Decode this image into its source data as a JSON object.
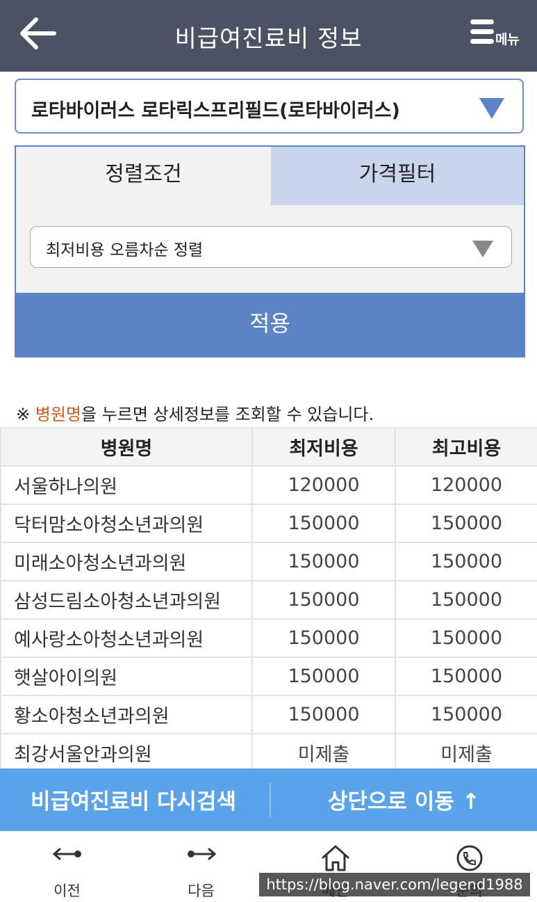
{
  "header": {
    "title": "비급여진료비 정보",
    "menu_label": "메뉴",
    "back_icon": "arrow-left-icon",
    "menu_icon": "hamburger-icon"
  },
  "product_select": {
    "value": "로타바이러스 로타릭스프리필드(로타바이러스)",
    "icon": "triangle-down-icon"
  },
  "filter": {
    "tabs": [
      {
        "label": "정렬조건",
        "active": true
      },
      {
        "label": "가격필터",
        "active": false
      }
    ],
    "sort_value": "최저비용 오름차순 정렬",
    "apply_label": "적용"
  },
  "notice": {
    "prefix": "※ ",
    "highlight": "병원명",
    "suffix": "을 누르면 상세정보를 조회할 수 있습니다."
  },
  "table": {
    "columns": [
      "병원명",
      "최저비용",
      "최고비용"
    ],
    "rows": [
      {
        "name": "서울하나의원",
        "min": "120000",
        "max": "120000"
      },
      {
        "name": "닥터맘소아청소년과의원",
        "min": "150000",
        "max": "150000"
      },
      {
        "name": "미래소아청소년과의원",
        "min": "150000",
        "max": "150000"
      },
      {
        "name": "삼성드림소아청소년과의원",
        "min": "150000",
        "max": "150000"
      },
      {
        "name": "예사랑소아청소년과의원",
        "min": "150000",
        "max": "150000"
      },
      {
        "name": "햇살아이의원",
        "min": "150000",
        "max": "150000"
      },
      {
        "name": "황소아청소년과의원",
        "min": "150000",
        "max": "150000"
      },
      {
        "name": "최강서울안과의원",
        "min": "미제출",
        "max": "미제출"
      }
    ]
  },
  "bottom_bar": {
    "research_label": "비급여진료비 다시검색",
    "top_label": "상단으로 이동 ↑"
  },
  "nav": {
    "items": [
      {
        "label": "이전",
        "icon": "arrow-left-dot-icon"
      },
      {
        "label": "다음",
        "icon": "arrow-right-dot-icon"
      },
      {
        "label": "메인",
        "icon": "home-icon"
      },
      {
        "label": "문의",
        "icon": "phone-icon"
      }
    ]
  },
  "watermark": "https://blog.naver.com/legend1988",
  "colors": {
    "header_bg": "#4a5263",
    "accent": "#5b83c6",
    "tab_inactive": "#c9d5ea",
    "bottom_bar": "#58a3ea",
    "highlight": "#d45a1b"
  }
}
